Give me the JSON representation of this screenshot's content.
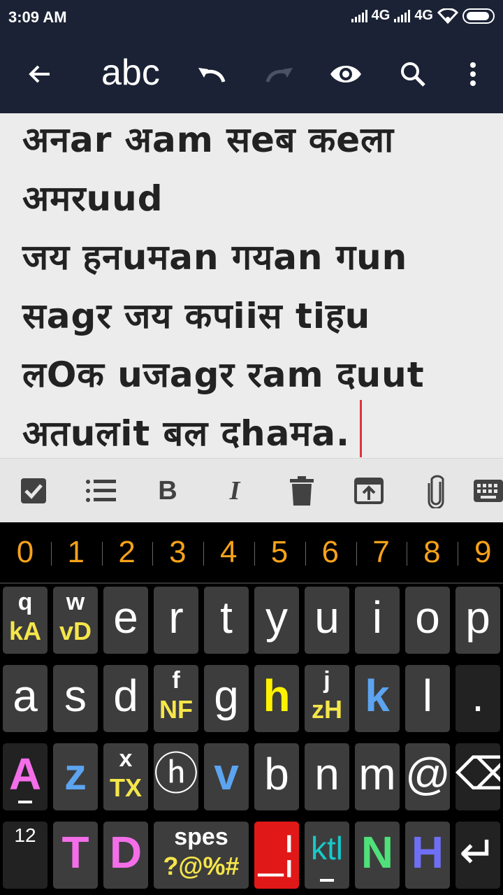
{
  "status": {
    "time": "3:09 AM",
    "net1": "4G",
    "net2": "4G"
  },
  "toolbar": {
    "title": "abc",
    "icons": [
      "back-arrow-icon",
      "undo-icon",
      "redo-icon",
      "eye-icon",
      "search-icon",
      "more-vert-icon"
    ]
  },
  "editor": {
    "lines": [
      "अनar अam सeब कeला",
      "अमरuud",
      "जय हनuमan गयan गun",
      "सagर जय कपiiस tiहu",
      "लOक uजagर रam दuut",
      "अतuलit बल दhaमa."
    ]
  },
  "formatbar": {
    "icons": [
      "checkbox-icon",
      "bullet-list-icon",
      "bold-icon",
      "italic-icon",
      "delete-icon",
      "share-icon",
      "attach-icon",
      "keyboard-icon"
    ],
    "bold": "B",
    "italic": "I"
  },
  "keyboard": {
    "numbers": [
      "0",
      "1",
      "2",
      "3",
      "4",
      "5",
      "6",
      "7",
      "8",
      "9"
    ],
    "row1": [
      {
        "top": "q",
        "bot": "kA",
        "botColor": "#f5e64a"
      },
      {
        "top": "w",
        "bot": "vD",
        "botColor": "#f5e64a"
      },
      {
        "main": "e"
      },
      {
        "main": "r"
      },
      {
        "main": "t"
      },
      {
        "main": "y"
      },
      {
        "main": "u"
      },
      {
        "main": "i"
      },
      {
        "main": "o"
      },
      {
        "main": "p"
      }
    ],
    "row2": [
      {
        "main": "a"
      },
      {
        "main": "s"
      },
      {
        "main": "d"
      },
      {
        "top": "f",
        "bot": "NF",
        "botColor": "#f5e64a"
      },
      {
        "main": "g"
      },
      {
        "main": "h",
        "color": "#fff200",
        "bold": true
      },
      {
        "top": "j",
        "bot": "zH",
        "botColor": "#f5e64a"
      },
      {
        "main": "k",
        "color": "#5ca4f0",
        "bold": true
      },
      {
        "main": "l"
      },
      {
        "main": ".",
        "dark": true
      }
    ],
    "row3": [
      {
        "main": "A",
        "color": "#f36ee8",
        "bold": true,
        "uscore": true,
        "dark": true
      },
      {
        "main": "z",
        "color": "#5ca4f0",
        "bold": true
      },
      {
        "top": "x",
        "bot": "TX",
        "botColor": "#f5e64a"
      },
      {
        "main": "ⓗ"
      },
      {
        "main": "v",
        "color": "#5ca4f0",
        "bold": true
      },
      {
        "main": "b"
      },
      {
        "main": "n"
      },
      {
        "main": "m"
      },
      {
        "main": "@"
      },
      {
        "main": "⌫",
        "dark": true,
        "icon": "backspace-icon"
      }
    ],
    "row4": [
      {
        "sm": "12",
        "dark": true
      },
      {
        "main": "T",
        "color": "#f36ee8",
        "bold": true
      },
      {
        "main": "D",
        "color": "#f36ee8",
        "bold": true
      },
      {
        "top": "spes",
        "bot": "?@%#",
        "botColor": "#f5e64a",
        "wide": true
      },
      {
        "main": "_¦",
        "color": "#fff",
        "bg": "#e11818",
        "icon": "red-cursor-key"
      },
      {
        "main": "ktl",
        "color": "#17c9c9",
        "uscore": true,
        "small": true
      },
      {
        "main": "N",
        "color": "#4fe07a",
        "bold": true
      },
      {
        "main": "H",
        "color": "#6f6ff5",
        "bold": true
      },
      {
        "main": "↵",
        "dark": true,
        "icon": "enter-icon"
      }
    ]
  }
}
